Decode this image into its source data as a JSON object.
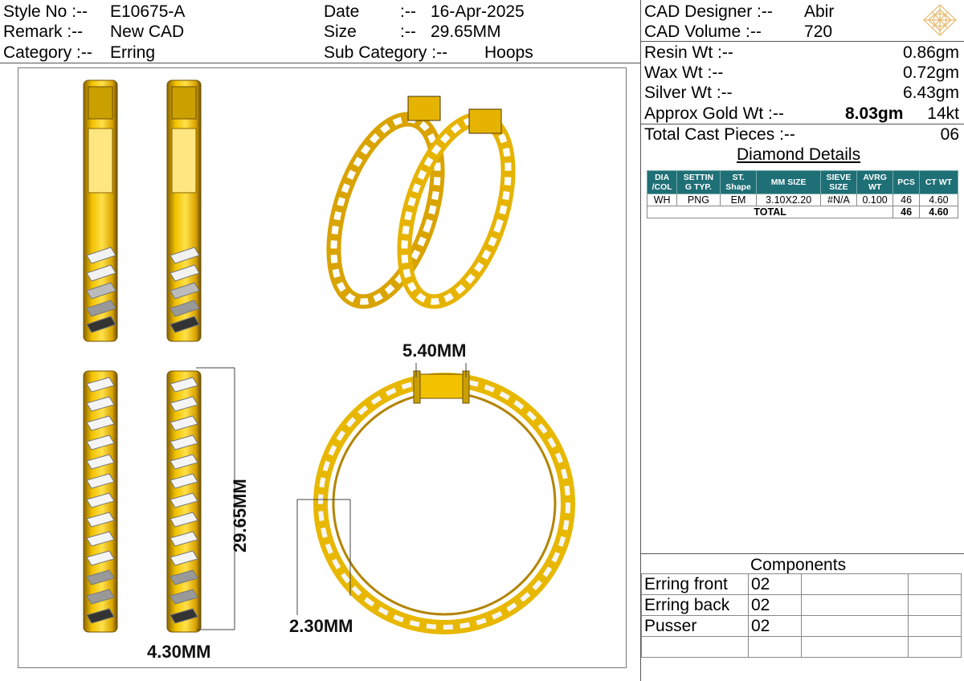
{
  "header": {
    "style_no_label": "Style No :--",
    "style_no": "E10675-A",
    "remark_label": "Remark  :--",
    "remark": "New CAD",
    "category_label": "Category :--",
    "category": "Erring",
    "date_label": "Date",
    "date_sep": ":--",
    "date": "16-Apr-2025",
    "size_label": "Size",
    "size_sep": ":--",
    "size": "29.65MM",
    "subcategory_label": "Sub Category :--",
    "subcategory": "Hoops"
  },
  "cad": {
    "designer_label": "CAD   Designer :--",
    "designer": "Abir",
    "volume_label": "CAD    Volume  :--",
    "volume": "720"
  },
  "weights": {
    "resin_label": "Resin Wt :--",
    "resin": "0.86gm",
    "wax_label": "Wax   Wt :--",
    "wax": "0.72gm",
    "silver_label": "Silver Wt :--",
    "silver": "6.43gm",
    "gold_label": "Approx Gold Wt :--",
    "gold": "8.03gm",
    "gold_karat": "14kt",
    "cast_label": "Total Cast Pieces :--",
    "cast": "06"
  },
  "diamond": {
    "title": "Diamond Details",
    "headers": [
      [
        "DIA",
        "/COL"
      ],
      [
        "SETTIN",
        "G TYP."
      ],
      [
        "ST.",
        "Shape"
      ],
      [
        "MM SIZE"
      ],
      [
        "SIEVE",
        "SIZE"
      ],
      [
        "AVRG",
        "WT"
      ],
      [
        "PCS"
      ],
      [
        "CT WT"
      ]
    ],
    "rows": [
      [
        "WH",
        "PNG",
        "EM",
        "3.10X2.20",
        "#N/A",
        "0.100",
        "46",
        "4.60"
      ]
    ],
    "total_label": "TOTAL",
    "total_pcs": "46",
    "total_ct": "4.60"
  },
  "components": {
    "title": "Components",
    "rows": [
      {
        "name": "Erring front",
        "qty": "02"
      },
      {
        "name": "Erring back",
        "qty": "02"
      },
      {
        "name": "Pusser",
        "qty": "02"
      }
    ]
  },
  "dimensions": {
    "height": "29.65MM",
    "width_side": "4.30MM",
    "top_width": "5.40MM",
    "ring_width": "2.30MM"
  },
  "colors": {
    "gold": "#f2c200",
    "gold_dark": "#8a6400",
    "stone": "#eeeeee",
    "table_header": "#1f6f76"
  },
  "icons": {
    "logo": "diamond-crest-icon"
  }
}
